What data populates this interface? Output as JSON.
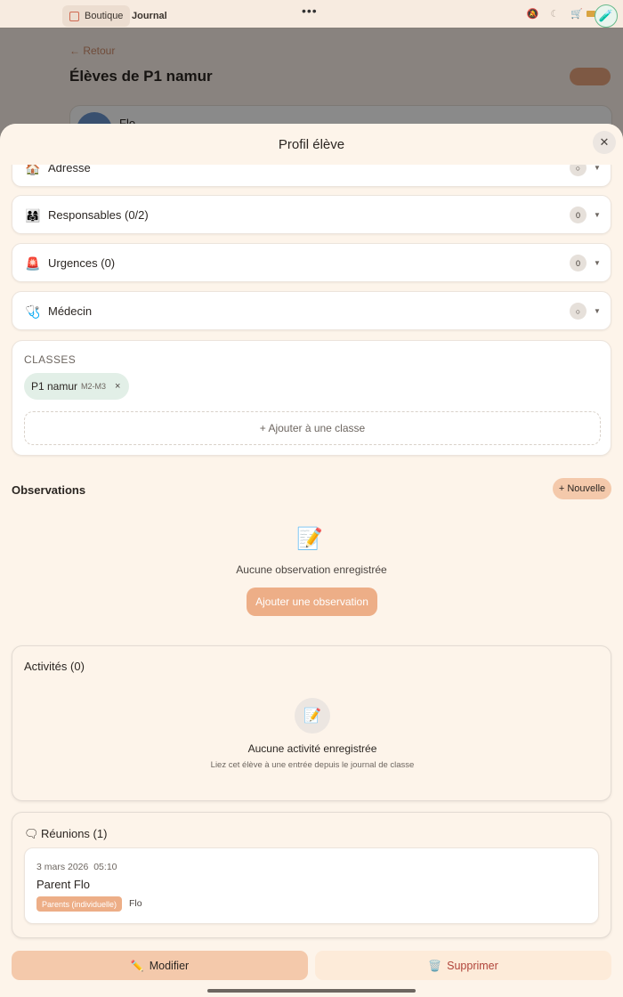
{
  "statusbar": {
    "tabs": [
      {
        "label": "Boutique",
        "icon": "bag-icon"
      },
      {
        "label": "Journal"
      }
    ],
    "menu_dots": "•••",
    "quick_icons": "🔕 ☾ 🛒"
  },
  "background": {
    "back_link": "← Retour",
    "page_title": "Élèves de P1 namur",
    "student_preview_name": "Flo"
  },
  "sheet": {
    "title": "Profil élève",
    "close_label": "✕",
    "sections": [
      {
        "label": "Adresse",
        "badge": "○",
        "icon": "house-icon"
      },
      {
        "label": "Responsables (0/2)",
        "badge": "0",
        "icon": "family-icon"
      },
      {
        "label": "Urgences (0)",
        "badge": "0",
        "icon": "siren-icon"
      },
      {
        "label": "Médecin",
        "badge": "○",
        "icon": "stethoscope-icon"
      }
    ],
    "chevron": "▼",
    "classes": {
      "title": "CLASSES",
      "chips": [
        {
          "name": "P1 namur",
          "level": "M2-M3",
          "remove": "×"
        }
      ],
      "add_label": "+ Ajouter à une classe"
    },
    "observations": {
      "title": "Observations",
      "new_button": "+ Nouvelle",
      "empty_icon": "📝",
      "empty_text": "Aucune observation enregistrée",
      "add_button": "Ajouter une observation"
    },
    "activities": {
      "title": "Activités (0)",
      "empty_icon": "📝",
      "empty_text": "Aucune activité enregistrée",
      "empty_sub": "Liez cet élève à une entrée depuis le journal de classe"
    },
    "meetings": {
      "title": "Réunions (1)",
      "icon": "chat-bubble-icon",
      "items": [
        {
          "date": "3 mars 2026",
          "time": "05:10",
          "name": "Parent Flo",
          "tag": "Parents (individuelle)",
          "person": "Flo"
        }
      ]
    },
    "actions": {
      "edit_label": "Modifier",
      "edit_emoji": "✏️",
      "delete_label": "Supprimer",
      "delete_emoji": "🗑️"
    }
  },
  "colors": {
    "sheet_bg": "#fdf4ea",
    "accent": "#edae87",
    "accent_light": "#f4c9ab",
    "class_chip": "#e2efe7",
    "danger_text": "#b0443a"
  }
}
